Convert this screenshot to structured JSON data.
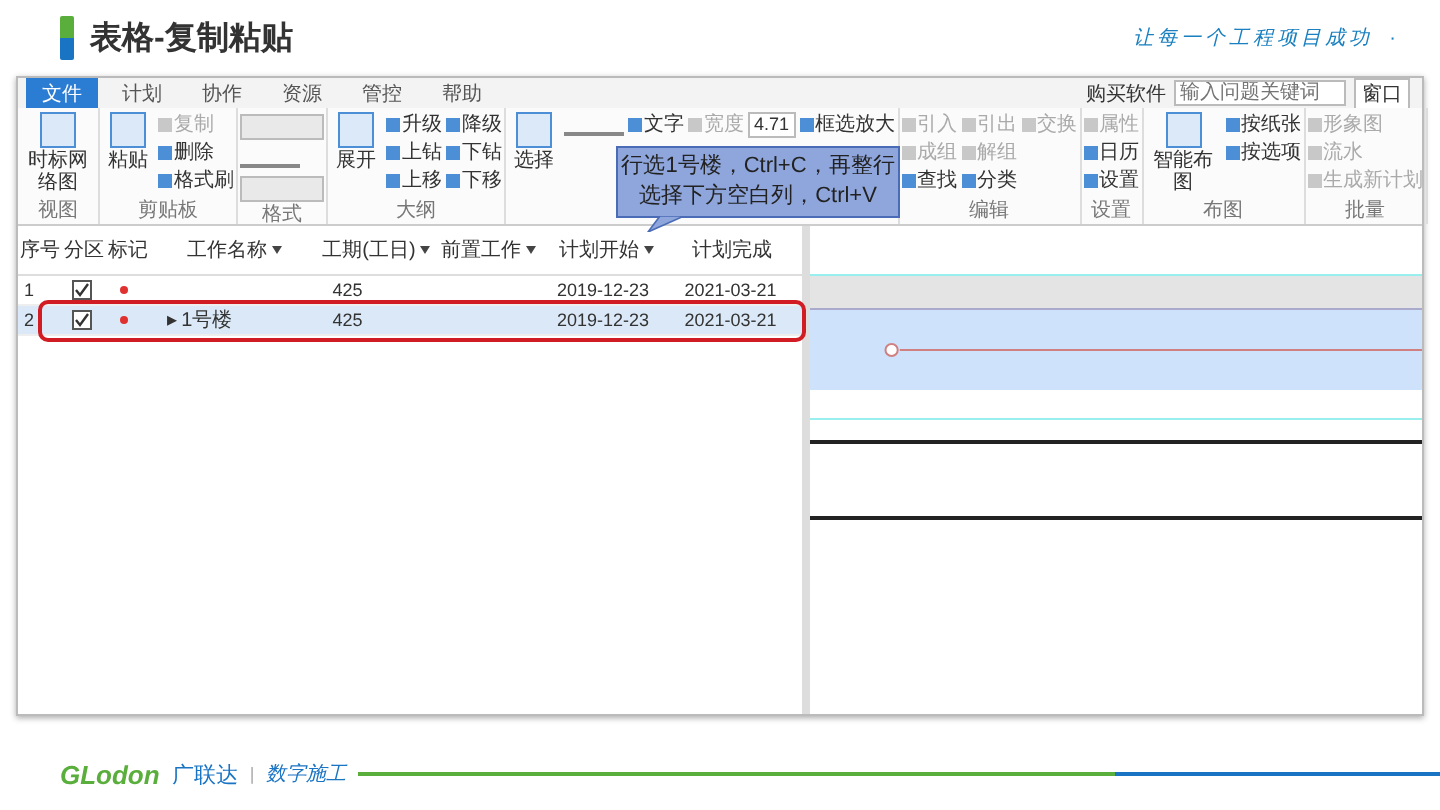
{
  "slide": {
    "title": "表格-复制粘贴",
    "tagline": "让每一个工程项目成功",
    "dot": "·"
  },
  "app": {
    "menu_tabs": [
      {
        "label": "文件",
        "selected": true
      },
      {
        "label": "计划",
        "selected": false
      },
      {
        "label": "协作",
        "selected": false
      },
      {
        "label": "资源",
        "selected": false
      },
      {
        "label": "管控",
        "selected": false
      },
      {
        "label": "帮助",
        "selected": false
      }
    ],
    "top_right": {
      "buy": "购买软件",
      "search_placeholder": "输入问题关键词",
      "window": "窗口"
    },
    "ribbon": [
      {
        "label": "视图",
        "columns": [
          [
            {
              "kind": "large",
              "text": "时标网络图"
            }
          ]
        ]
      },
      {
        "label": "剪贴板",
        "columns": [
          [
            {
              "kind": "large",
              "text": "粘贴"
            }
          ],
          [
            {
              "kind": "small",
              "text": "复制",
              "disabled": true
            },
            {
              "kind": "small",
              "text": "删除",
              "disabled": false
            },
            {
              "kind": "small",
              "text": "格式刷",
              "disabled": false
            }
          ]
        ]
      },
      {
        "label": "格式",
        "columns": [
          [
            {
              "kind": "dropdown"
            },
            {
              "kind": "icon"
            },
            {
              "kind": "dropdown"
            }
          ]
        ]
      },
      {
        "label": "大纲",
        "columns": [
          [
            {
              "kind": "large",
              "text": "展开"
            }
          ],
          [
            {
              "kind": "small",
              "text": "升级",
              "disabled": false
            },
            {
              "kind": "small",
              "text": "上钻",
              "disabled": false
            },
            {
              "kind": "small",
              "text": "上移",
              "disabled": false
            }
          ],
          [
            {
              "kind": "small",
              "text": "降级",
              "disabled": false
            },
            {
              "kind": "small",
              "text": "下钻",
              "disabled": false
            },
            {
              "kind": "small",
              "text": "下移",
              "disabled": false
            }
          ]
        ]
      },
      {
        "columns": [
          [
            {
              "kind": "large",
              "text": "选择"
            }
          ],
          [
            {
              "kind": "icon"
            }
          ],
          [
            {
              "kind": "small",
              "text": "文字",
              "disabled": false
            }
          ],
          [
            {
              "kind": "small",
              "text": "宽度",
              "disabled": true
            }
          ],
          [
            {
              "kind": "field",
              "text": "4.71"
            }
          ],
          [
            {
              "kind": "small",
              "text": "框选放大",
              "disabled": false
            }
          ]
        ]
      },
      {
        "label": "编辑",
        "columns": [
          [
            {
              "kind": "small",
              "text": "引入",
              "disabled": true
            },
            {
              "kind": "small",
              "text": "成组",
              "disabled": true
            },
            {
              "kind": "small",
              "text": "查找",
              "disabled": false
            }
          ],
          [
            {
              "kind": "small",
              "text": "引出",
              "disabled": true
            },
            {
              "kind": "small",
              "text": "解组",
              "disabled": true
            },
            {
              "kind": "small",
              "text": "分类",
              "disabled": false
            }
          ],
          [
            {
              "kind": "small",
              "text": "交换",
              "disabled": true
            }
          ]
        ]
      },
      {
        "label": "设置",
        "columns": [
          [
            {
              "kind": "small",
              "text": "属性",
              "disabled": true
            },
            {
              "kind": "small",
              "text": "日历",
              "disabled": false
            },
            {
              "kind": "small",
              "text": "设置",
              "disabled": false
            }
          ]
        ]
      },
      {
        "label": "布图",
        "columns": [
          [
            {
              "kind": "large",
              "text": "智能布图"
            }
          ],
          [
            {
              "kind": "small",
              "text": "按纸张",
              "disabled": false
            },
            {
              "kind": "small",
              "text": "按选项",
              "disabled": false
            }
          ]
        ]
      },
      {
        "label": "批量",
        "columns": [
          [
            {
              "kind": "small",
              "text": "形象图",
              "disabled": true
            },
            {
              "kind": "small",
              "text": "流水",
              "disabled": true
            },
            {
              "kind": "small",
              "text": "生成新计划",
              "disabled": true
            }
          ]
        ]
      }
    ],
    "table": {
      "columns": [
        {
          "label": "序号",
          "filter": false
        },
        {
          "label": "分区",
          "filter": false
        },
        {
          "label": "标记",
          "filter": false
        },
        {
          "label": "工作名称",
          "filter": true
        },
        {
          "label": "工期(工日)",
          "filter": true
        },
        {
          "label": "前置工作",
          "filter": true
        },
        {
          "label": "计划开始",
          "filter": true
        },
        {
          "label": "计划完成",
          "filter": false
        }
      ],
      "rows": [
        {
          "index": "1",
          "checked": true,
          "flagged": true,
          "duration": "425",
          "start": "2019-12-23",
          "finish": "2021-03-21",
          "selected": false,
          "highlighted": false
        },
        {
          "index": "2",
          "checked": true,
          "flagged": true,
          "expander": "▸",
          "name": "1号楼",
          "duration": "425",
          "start": "2019-12-23",
          "finish": "2021-03-21",
          "selected": true,
          "highlighted": true
        }
      ]
    },
    "callout": {
      "lines": [
        "行选1号楼，Ctrl+C，再整行",
        "选择下方空白列，Ctrl+V"
      ]
    }
  },
  "footer": {
    "logo": "GLodon",
    "brand": "广联达",
    "separator": "|",
    "slogan": "数字施工"
  }
}
